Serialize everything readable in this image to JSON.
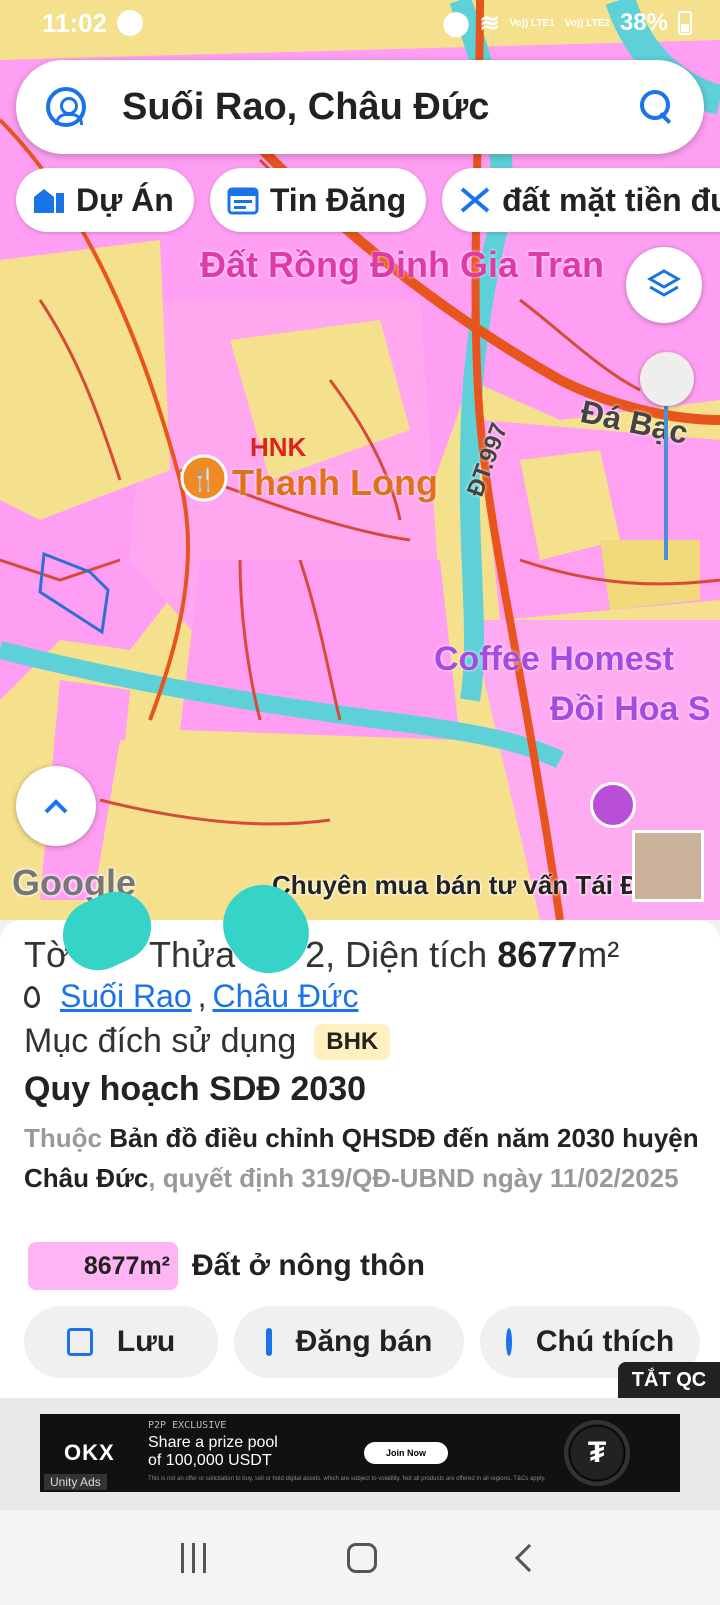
{
  "status": {
    "time": "11:02",
    "lte1": "Vo)) LTE1",
    "lte2": "Vo)) LTE2",
    "battery": "38%"
  },
  "search": {
    "query": "Suối Rao, Châu Đức"
  },
  "chips": [
    {
      "label": "Dự Án",
      "icon": "building-icon"
    },
    {
      "label": "Tin Đăng",
      "icon": "calendar-icon"
    },
    {
      "label": "đất mặt tiền đườ",
      "icon": "tools-icon"
    }
  ],
  "map": {
    "labels": {
      "place_top": "Đất Rồng Đinh Gia Tran",
      "hnk": "HNK",
      "thanh_long": "Thanh Long",
      "da_bac": "Đá Bạc",
      "road": "ĐT.997",
      "coffee_line1": "Coffee Homest",
      "coffee_line2": "Đồi Hoa S",
      "google": "Google",
      "promo": "Chuyên mua bán tư vấn Tái Đị"
    },
    "colors": {
      "residential": "#ff9ff3",
      "agri": "#f7e7a0",
      "road": "#e8541e",
      "water": "#5ed0d8"
    }
  },
  "sheet": {
    "parcel_prefix": "Tờ ",
    "parcel_mid": " Thửa ",
    "parcel_tail": "2, Diện tích ",
    "area": "8677",
    "area_unit": "m²",
    "location_ward": "Suối Rao",
    "location_sep": ",",
    "location_district": "Châu Đức",
    "purpose_label": "Mục đích sử dụng",
    "purpose_badge": "BHK",
    "plan_title": "Quy hoạch SDĐ 2030",
    "plan_desc_1": "Thuộc ",
    "plan_desc_2": "Bản đồ điều chỉnh QHSDĐ đến năm 2030 huyện Châu Đức",
    "plan_desc_3": ", quyết định 319/QĐ-UBND ngày 11/02/2025",
    "landuse_area": "8677m²",
    "landuse_label": "Đất ở nông thôn",
    "actions": {
      "save": "Lưu",
      "post": "Đăng bán",
      "legend": "Chú thích"
    },
    "hide_ads": "TẮT QC"
  },
  "ad": {
    "brand": "OKX",
    "tag": "P2P EXCLUSIVE",
    "headline_1": "Share a prize pool",
    "headline_2": "of 100,000 USDT",
    "cta": "Join Now",
    "fine_print": "This is not an offer or solicitation to buy, sell or hold digital assets, which are subject to volatility. Not all products are offered in all regions. T&Cs apply.",
    "provider": "Unity Ads"
  }
}
